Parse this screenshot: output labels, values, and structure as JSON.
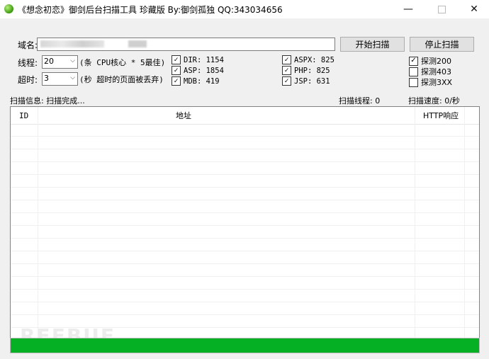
{
  "window": {
    "title": "《想念初恋》御剑后台扫描工具 珍藏版 By:御剑孤独 QQ:343034656",
    "min_glyph": "—",
    "close_glyph": "✕"
  },
  "form": {
    "domain_label": "域名:",
    "domain_value": "",
    "threads_label": "线程:",
    "threads_value": "20",
    "threads_hint": "(条 CPU核心 * 5最佳)",
    "timeout_label": "超时:",
    "timeout_value": "3",
    "timeout_hint": "(秒 超时的页面被丢弃)"
  },
  "buttons": {
    "start": "开始扫描",
    "stop": "停止扫描"
  },
  "dictionaries": [
    {
      "label": "DIR: 1154",
      "checked": true
    },
    {
      "label": "ASP: 1854",
      "checked": true
    },
    {
      "label": "MDB: 419",
      "checked": true
    },
    {
      "label": "ASPX: 825",
      "checked": true
    },
    {
      "label": "PHP: 825",
      "checked": true
    },
    {
      "label": "JSP: 631",
      "checked": true
    }
  ],
  "probes": [
    {
      "label": "探测200",
      "checked": true
    },
    {
      "label": "探测403",
      "checked": false
    },
    {
      "label": "探测3XX",
      "checked": false
    }
  ],
  "status": {
    "info": "扫描信息: 扫描完成...",
    "threads": "扫描线程: 0",
    "speed": "扫描速度: 0/秒"
  },
  "table": {
    "columns": [
      "ID",
      "地址",
      "HTTP响应"
    ],
    "rows": []
  },
  "watermark": "REEBUF",
  "progress": {
    "value": 1.0,
    "color": "#06b025"
  }
}
